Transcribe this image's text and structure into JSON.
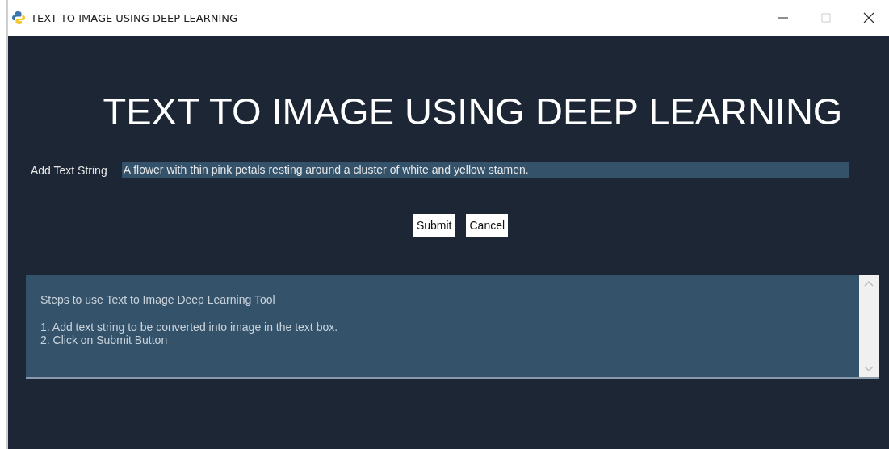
{
  "window": {
    "title": "TEXT TO IMAGE USING DEEP LEARNING"
  },
  "heading": "TEXT TO IMAGE USING DEEP LEARNING",
  "text_input": {
    "label": "Add Text String",
    "value": "A flower with thin pink petals resting around a cluster of white and yellow stamen."
  },
  "buttons": [
    "Submit",
    "Cancel"
  ],
  "instructions": {
    "title": "Steps to use Text to Image Deep Learning Tool",
    "steps": [
      "1. Add text string to be converted into image in the text box.",
      "2. Click on Submit Button"
    ]
  }
}
